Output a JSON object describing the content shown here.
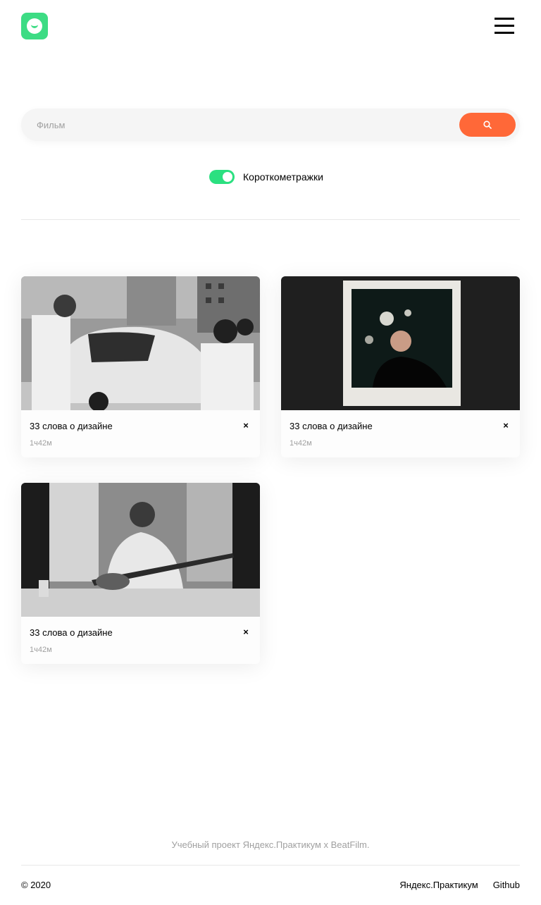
{
  "header": {
    "logo_icon": "smile-logo-icon",
    "menu_icon": "burger-menu-icon",
    "accent_color": "#3ddc84"
  },
  "search": {
    "placeholder": "Фильм",
    "value": "",
    "button_icon": "search-icon",
    "button_color": "#ff6838"
  },
  "filter": {
    "short_films_label": "Короткометражки",
    "short_films_on": true
  },
  "movies": [
    {
      "title": "33 слова о дизайне",
      "duration": "1ч42м",
      "delete_label": "×"
    },
    {
      "title": "33 слова о дизайне",
      "duration": "1ч42м",
      "delete_label": "×"
    },
    {
      "title": "33 слова о дизайне",
      "duration": "1ч42м",
      "delete_label": "×"
    }
  ],
  "footer": {
    "note": "Учебный проект Яндекс.Практикум х BeatFilm.",
    "copyright": "© 2020",
    "links": [
      "Яндекс.Практикум",
      "Github"
    ]
  }
}
